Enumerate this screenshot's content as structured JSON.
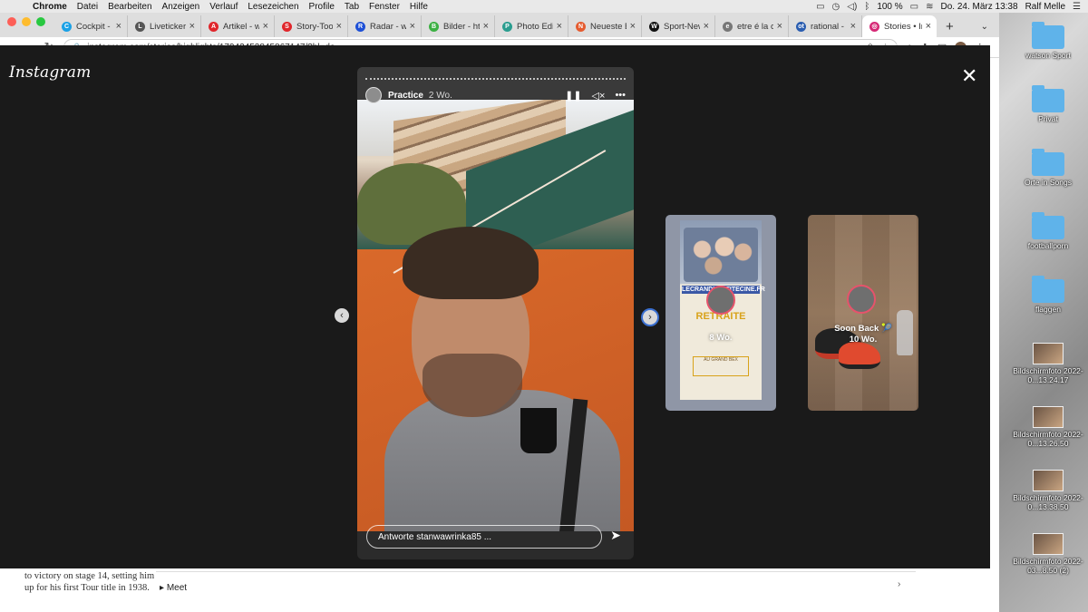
{
  "menubar": {
    "app": "Chrome",
    "items": [
      "Datei",
      "Bearbeiten",
      "Anzeigen",
      "Verlauf",
      "Lesezeichen",
      "Profile",
      "Tab",
      "Fenster",
      "Hilfe"
    ],
    "battery": "100 %",
    "datetime": "Do. 24. März 13:38",
    "user": "Ralf Melle"
  },
  "tabs": [
    {
      "label": "Cockpit - w",
      "color": "#1aa1e6",
      "glyph": "C"
    },
    {
      "label": "Liveticker -",
      "color": "#555555",
      "glyph": "L"
    },
    {
      "label": "Artikel - w",
      "color": "#e0262b",
      "glyph": "A"
    },
    {
      "label": "Story-Tool",
      "color": "#e0262b",
      "glyph": "S"
    },
    {
      "label": "Radar - w",
      "color": "#1d4fd6",
      "glyph": "R"
    },
    {
      "label": "Bilder - http",
      "color": "#3cb043",
      "glyph": "B"
    },
    {
      "label": "Photo Edito",
      "color": "#2a9d8f",
      "glyph": "P"
    },
    {
      "label": "Neueste Ei",
      "color": "#e55b2f",
      "glyph": "N"
    },
    {
      "label": "Sport-New",
      "color": "#111111",
      "glyph": "W"
    },
    {
      "label": "etre é la ca",
      "color": "#777777",
      "glyph": "e"
    },
    {
      "label": "rational - S",
      "color": "#2a5db0",
      "glyph": "ot"
    },
    {
      "label": "Stories • In",
      "color": "#d62976",
      "glyph": "◎",
      "active": true
    }
  ],
  "address": {
    "url": "instagram.com/stories/highlights/17942453845867147/?hl=de"
  },
  "instagram": {
    "logo": "Instagram",
    "story": {
      "username": "Practice",
      "time": "2 Wo.",
      "reply_placeholder": "Antworte stanwawrinka85 ..."
    },
    "previews": [
      {
        "label": "Mon...\n8 Wo.",
        "title_line": "8 Wo.",
        "poster_site": "LECRANDUPETITECINE.FR",
        "poster_title": "RETRAITE",
        "poster_sub": "AU GRAND BEX"
      },
      {
        "label": "Soon Back 🎾",
        "time": "10 Wo."
      }
    ]
  },
  "page_under": {
    "text": "to victory on stage 14, setting him up for his first Tour title in 1938.",
    "meet": "Meet"
  },
  "desktop": [
    {
      "label": "watson Sport",
      "type": "folder"
    },
    {
      "label": "Privat",
      "type": "folder"
    },
    {
      "label": "Orte in Songs",
      "type": "folder"
    },
    {
      "label": "footballporn",
      "type": "folder"
    },
    {
      "label": "flaggen",
      "type": "folder"
    },
    {
      "label": "Bildschirmfoto 2022-0...13.24.17",
      "type": "thumb"
    },
    {
      "label": "Bildschirmfoto 2022-0...13.26.50",
      "type": "thumb"
    },
    {
      "label": "Bildschirmfoto 2022-0...13.38.50",
      "type": "thumb"
    },
    {
      "label": "Bildschirmfoto 2022-03...8.50 (2)",
      "type": "thumb"
    }
  ]
}
